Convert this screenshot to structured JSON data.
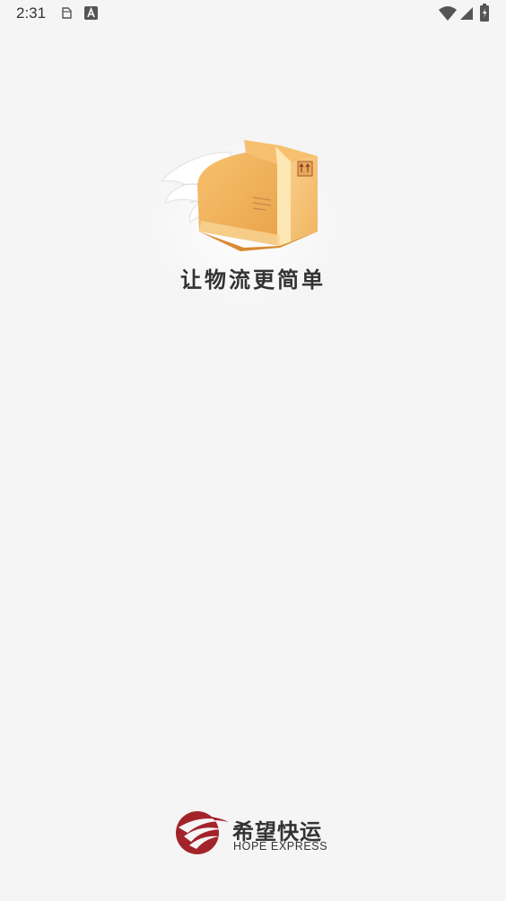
{
  "status_bar": {
    "time": "2:31",
    "icons": [
      "notification-file-icon",
      "notification-a-icon",
      "wifi-icon",
      "cell-signal-icon",
      "battery-charging-icon"
    ]
  },
  "splash": {
    "slogan": "让物流更简单",
    "illustration": "winged-package-icon"
  },
  "brand": {
    "name_cn": "希望快运",
    "name_en": "HOPE EXPRESS",
    "logo": "hope-express-logo",
    "color": "#a3232b"
  },
  "colors": {
    "background": "#f5f5f5",
    "text": "#333333",
    "box": "#f3b665",
    "box_dark": "#e59a3c"
  }
}
